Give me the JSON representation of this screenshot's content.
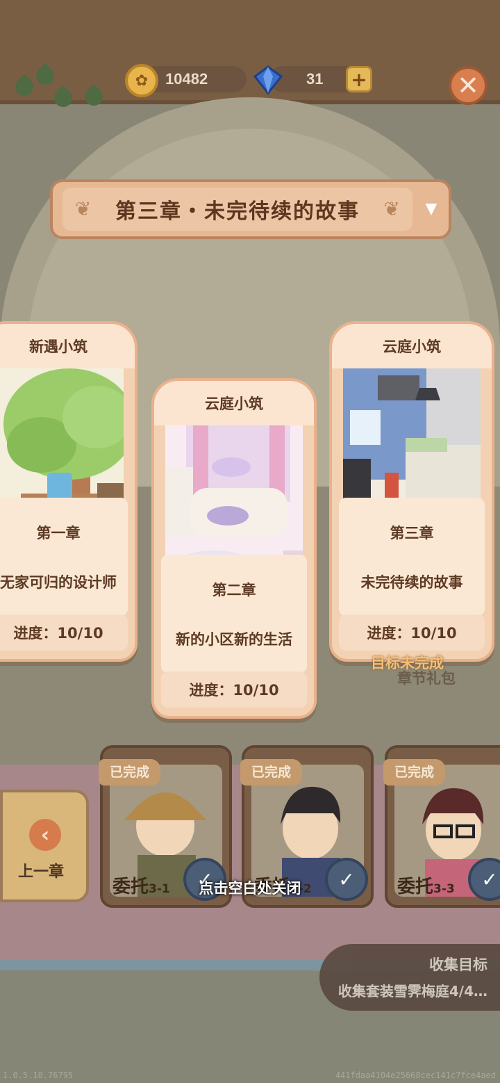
{
  "resources": {
    "coins": "10482",
    "gems": "31",
    "plus_icon": "plus-icon",
    "close_icon": "close-icon"
  },
  "chapter_select": {
    "title": "第三章・未完待续的故事",
    "arrow": "▼"
  },
  "cards": [
    {
      "name": "新遇小筑",
      "chapter": "第一章",
      "story": "无家可归的设计师",
      "progress": "进度：10/10",
      "progress_fraction": 1.0
    },
    {
      "name": "云庭小筑",
      "chapter": "第二章",
      "story": "新的小区新的生活",
      "progress": "进度：10/10",
      "progress_fraction": 1.0
    },
    {
      "name": "云庭小筑",
      "chapter": "第三章",
      "story": "未完待续的故事",
      "progress": "进度：10/10",
      "progress_fraction": 1.0
    }
  ],
  "goal_status": "目标未完成",
  "gift_label": "章节礼包",
  "prev_chapter": {
    "label": "上一章"
  },
  "tasks": [
    {
      "tag": "已完成",
      "name": "委托",
      "num": "3-1"
    },
    {
      "tag": "已完成",
      "name": "委托",
      "num": "3-2"
    },
    {
      "tag": "已完成",
      "name": "委托",
      "num": "3-3"
    }
  ],
  "hint": "点击空白处关闭",
  "collect": {
    "title": "收集目标",
    "desc": "收集套装雪霁梅庭4/4…"
  },
  "footer": {
    "version": "1.0.5.10.76795",
    "hash": "441fdaa4104e25668cec141c7fce4aed"
  },
  "colors": {
    "card_bg": "#f3d2b3",
    "accent": "#d97e4e",
    "text": "#5d3a24"
  }
}
